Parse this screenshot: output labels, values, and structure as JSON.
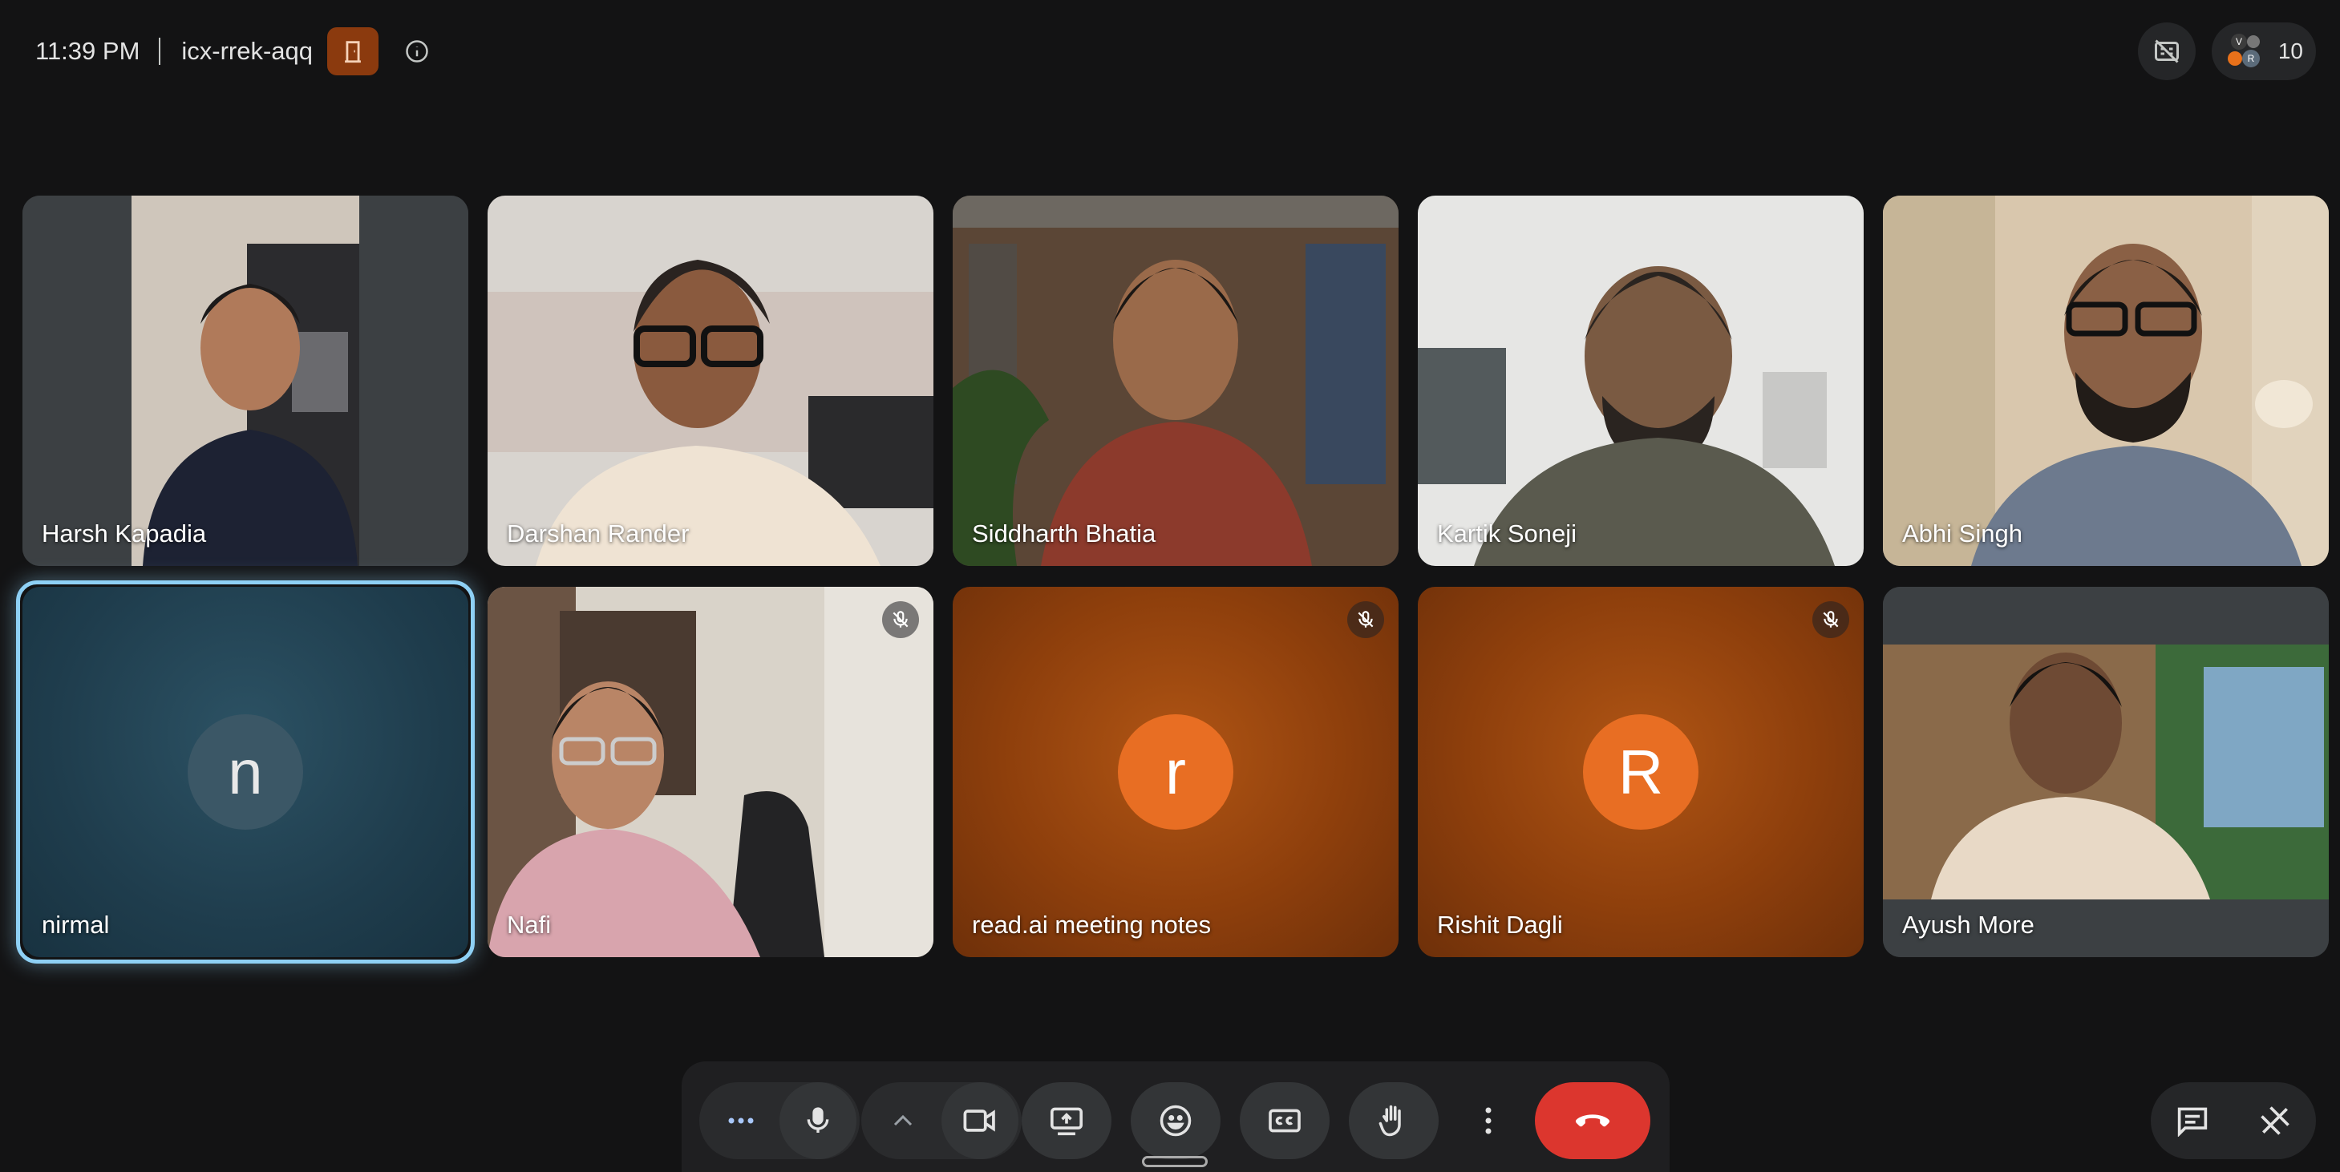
{
  "meeting": {
    "time": "11:39 PM",
    "code": "icx-rrek-aqq",
    "host_icon": "door-icon",
    "info_icon": "info-icon"
  },
  "top_right": {
    "captions_off_icon": "no-captions-icon",
    "people_count": "10",
    "people_icon_initials": [
      "V",
      "R"
    ]
  },
  "participants": [
    {
      "name": "Harsh Kapadia",
      "type": "video",
      "muted": false
    },
    {
      "name": "Darshan Rander",
      "type": "video",
      "muted": false
    },
    {
      "name": "Siddharth Bhatia",
      "type": "video",
      "muted": false
    },
    {
      "name": "Kartik Soneji",
      "type": "video",
      "muted": false
    },
    {
      "name": "Abhi Singh",
      "type": "video",
      "muted": false
    },
    {
      "name": "nirmal",
      "type": "avatar",
      "initial": "n",
      "muted": false,
      "active_speaker": true
    },
    {
      "name": "Nafi",
      "type": "video",
      "muted": true
    },
    {
      "name": "read.ai meeting notes",
      "type": "avatar",
      "initial": "r",
      "muted": true
    },
    {
      "name": "Rishit Dagli",
      "type": "avatar",
      "initial": "R",
      "muted": true
    },
    {
      "name": "Ayush More",
      "type": "video",
      "muted": false
    }
  ],
  "controls": {
    "more_audio": "more-options-icon",
    "mic": "mic-icon",
    "expand": "chevron-up-icon",
    "camera": "camera-icon",
    "present": "present-screen-icon",
    "reactions": "emoji-icon",
    "captions": "closed-captions-icon",
    "raise_hand": "raise-hand-icon",
    "more": "more-vertical-icon",
    "leave": "end-call-icon",
    "chat": "chat-icon",
    "activities": "activities-icon"
  },
  "colors": {
    "background": "#131314",
    "end_call": "#dc362e",
    "avatar_orange": "#e86e23",
    "active_speaker_ring": "#8ed0f5"
  }
}
